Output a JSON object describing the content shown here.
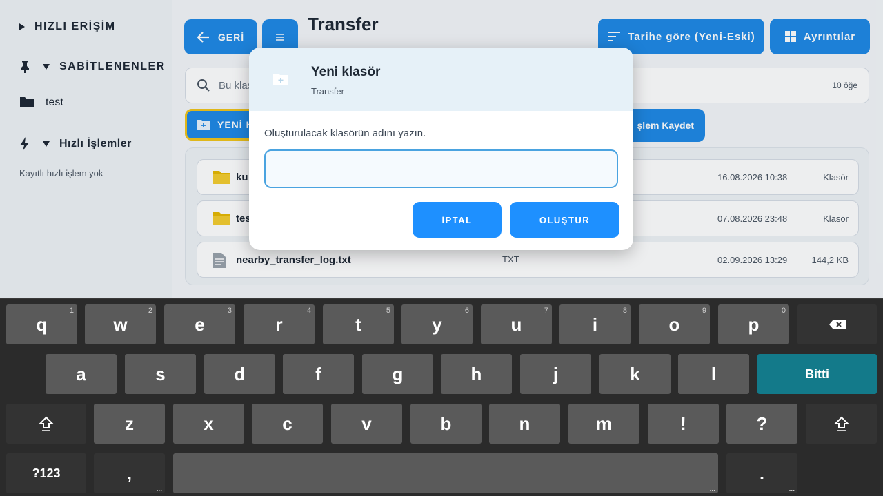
{
  "sidebar": {
    "quick_access": "HIZLI ERİŞİM",
    "pinned": "SABİTLENENLER",
    "pinned_items": [
      "test"
    ],
    "quick_actions": "Hızlı İşlemler",
    "quick_actions_empty": "Kayıtlı hızlı işlem yok"
  },
  "toolbar": {
    "back_label": "GERİ",
    "folder_title": "Transfer",
    "sort_label": "Tarihe göre (Yeni-Eski)",
    "details_label": "Ayrıntılar"
  },
  "search": {
    "placeholder": "Bu klasörde ara",
    "item_count": "10 öğe"
  },
  "actions": {
    "new_folder_label": "YENİ K",
    "save_op_label": "şlem Kaydet"
  },
  "files": [
    {
      "name": "ku",
      "type": "",
      "date": "16.08.2026 10:38",
      "size": "Klasör",
      "icon": "folder-icon"
    },
    {
      "name": "tes",
      "type": "",
      "date": "07.08.2026 23:48",
      "size": "Klasör",
      "icon": "folder-icon"
    },
    {
      "name": "nearby_transfer_log.txt",
      "type": "TXT",
      "date": "02.09.2026 13:29",
      "size": "144,2 KB",
      "icon": "text-file-icon"
    }
  ],
  "dialog": {
    "title": "Yeni klasör",
    "subtitle": "Transfer",
    "prompt": "Oluşturulacak klasörün adını yazın.",
    "input_value": "",
    "cancel_label": "İPTAL",
    "create_label": "OLUŞTUR"
  },
  "keyboard": {
    "row1": [
      {
        "k": "q",
        "h": "1"
      },
      {
        "k": "w",
        "h": "2"
      },
      {
        "k": "e",
        "h": "3"
      },
      {
        "k": "r",
        "h": "4"
      },
      {
        "k": "t",
        "h": "5"
      },
      {
        "k": "y",
        "h": "6"
      },
      {
        "k": "u",
        "h": "7"
      },
      {
        "k": "i",
        "h": "8"
      },
      {
        "k": "o",
        "h": "9"
      },
      {
        "k": "p",
        "h": "0"
      }
    ],
    "row2": [
      "a",
      "s",
      "d",
      "f",
      "g",
      "h",
      "j",
      "k",
      "l"
    ],
    "row3": [
      "z",
      "x",
      "c",
      "v",
      "b",
      "n",
      "m",
      "!",
      "?"
    ],
    "done_label": "Bitti",
    "symbols_label": "?123",
    "comma": ",",
    "period": "."
  },
  "colors": {
    "accent": "#1e88e5",
    "dialog_button": "#1e90ff",
    "done_key": "#137a8a",
    "highlight_border": "#f0c419"
  }
}
